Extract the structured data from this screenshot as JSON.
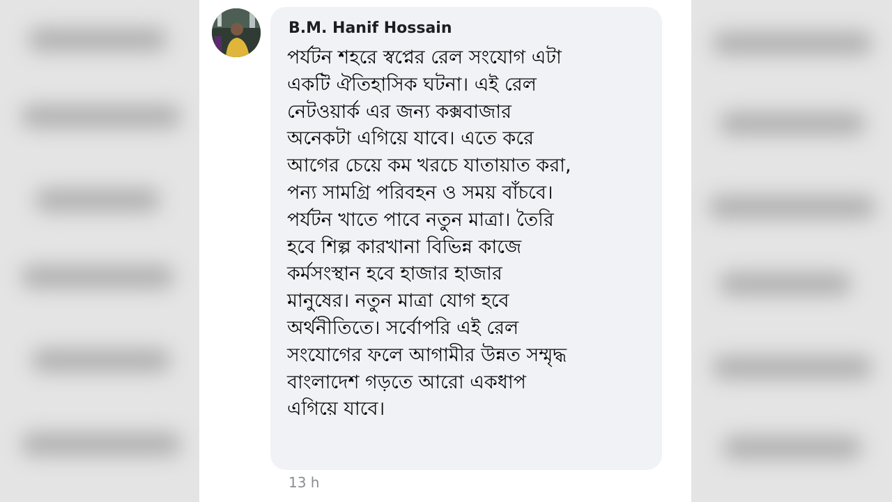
{
  "comment": {
    "author": "B.M. Hanif Hossain",
    "lines": [
      "পর্যটন শহরে স্বপ্নের রেল সংযোগ এটা",
      "একটি ঐতিহাসিক ঘটনা। এই রেল",
      "নেটওয়ার্ক এর জন্য কক্সবাজার",
      "অনেকটা এগিয়ে যাবে। এতে করে",
      "আগের চেয়ে কম খরচে যাতায়াত করা,",
      "পন্য সামগ্রি পরিবহন ও সময় বাঁচবে।",
      "পর্যটন খাতে পাবে নতুন মাত্রা। তৈরি",
      "হবে শিল্প কারখানা বিভিন্ন কাজে",
      "কর্মসংস্থান হবে হাজার হাজার",
      "মানুষের। নতুন মাত্রা যোগ হবে",
      "অর্থনীতিতে। সর্বোপরি এই রেল",
      "সংযোগের ফলে আগামীর উন্নত সম্মৃদ্ধ",
      "বাংলাদেশ গড়তে আরো একধাপ",
      "এগিয়ে যাবে।"
    ],
    "timestamp": "13 h"
  },
  "colors": {
    "bubble_bg": "#f0f2f5",
    "text": "#050505",
    "muted": "#8a8d91"
  }
}
